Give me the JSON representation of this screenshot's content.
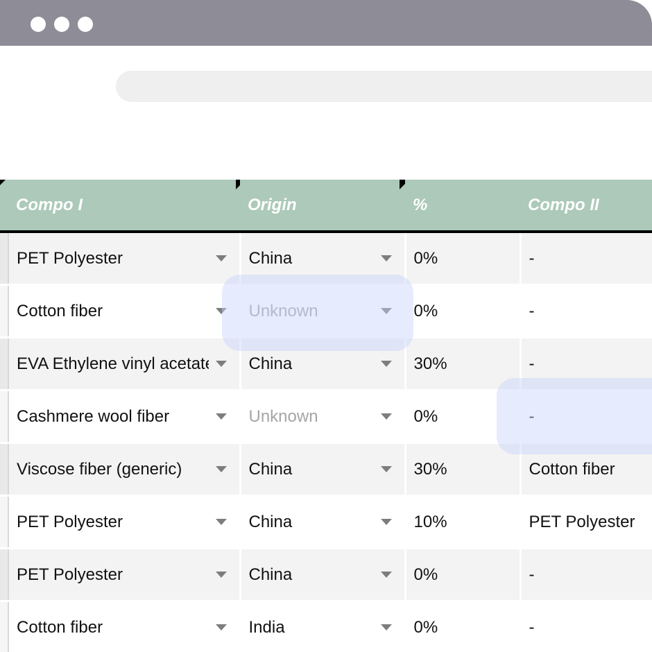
{
  "window": {
    "controls": [
      "dot",
      "dot",
      "dot"
    ]
  },
  "sheet": {
    "header_color": "#acc9b9",
    "columns": [
      "",
      "Compo I",
      "Origin",
      "%",
      "Compo II"
    ],
    "rows": [
      {
        "compo1": "PET Polyester",
        "origin": "China",
        "origin_muted": false,
        "pct": "0%",
        "compo2": "-"
      },
      {
        "compo1": "Cotton fiber",
        "origin": "Unknown",
        "origin_muted": true,
        "pct": "0%",
        "compo2": "-"
      },
      {
        "compo1": "EVA Ethylene vinyl acetate",
        "origin": "China",
        "origin_muted": false,
        "pct": "30%",
        "compo2": "-"
      },
      {
        "compo1": "Cashmere wool fiber",
        "origin": "Unknown",
        "origin_muted": true,
        "pct": "0%",
        "compo2": "-"
      },
      {
        "compo1": "Viscose fiber (generic)",
        "origin": "China",
        "origin_muted": false,
        "pct": "30%",
        "compo2": "Cotton fiber"
      },
      {
        "compo1": "PET Polyester",
        "origin": "China",
        "origin_muted": false,
        "pct": "10%",
        "compo2": "PET Polyester"
      },
      {
        "compo1": "PET Polyester",
        "origin": "China",
        "origin_muted": false,
        "pct": "0%",
        "compo2": "-"
      },
      {
        "compo1": "Cotton fiber",
        "origin": "India",
        "origin_muted": false,
        "pct": "0%",
        "compo2": "-"
      }
    ]
  }
}
